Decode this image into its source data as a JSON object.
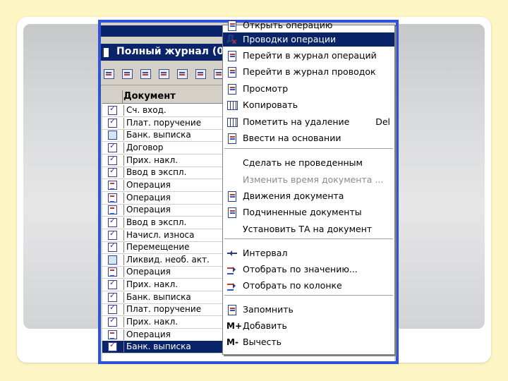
{
  "window": {
    "title": "Полный журнал (01"
  },
  "grid": {
    "column_header": "Документ",
    "rows": [
      {
        "name": "Сч. вход.",
        "mark": "check"
      },
      {
        "name": "Плат. поручение",
        "mark": "check"
      },
      {
        "name": "Банк. выписка",
        "mark": "plain"
      },
      {
        "name": "Договор",
        "mark": "check"
      },
      {
        "name": "Прих. накл.",
        "mark": "check"
      },
      {
        "name": "Ввод в экспл.",
        "mark": "check"
      },
      {
        "name": "Операция",
        "mark": "op"
      },
      {
        "name": "Операция",
        "mark": "op"
      },
      {
        "name": "Операция",
        "mark": "op"
      },
      {
        "name": "Ввод в экспл.",
        "mark": "check"
      },
      {
        "name": "Начисл. износа",
        "mark": "check"
      },
      {
        "name": "Перемещение",
        "mark": "check"
      },
      {
        "name": "Ликвид. необ. акт.",
        "mark": "plain"
      },
      {
        "name": "Операция",
        "mark": "op"
      },
      {
        "name": "Прих. накл.",
        "mark": "check"
      },
      {
        "name": "Банк. выписка",
        "mark": "check"
      },
      {
        "name": "Плат. поручение",
        "mark": "check"
      },
      {
        "name": "Прих. накл.",
        "mark": "check"
      },
      {
        "name": "Операция",
        "mark": "op"
      },
      {
        "name": "Банк. выписка",
        "mark": "check"
      }
    ]
  },
  "context_menu": {
    "items": [
      {
        "label": "Открыть операцию",
        "icon": "document-icon"
      },
      {
        "label": "Проводки операции",
        "icon": "ddt-icon"
      },
      {
        "label": "Перейти в журнал операций",
        "icon": "journal-icon"
      },
      {
        "label": "Перейти в журнал проводок",
        "icon": "journal-icon"
      },
      {
        "label": "Просмотр",
        "icon": "view-icon"
      },
      {
        "label": "Копировать",
        "icon": "copy-icon"
      },
      {
        "label": "Пометить на удаление",
        "icon": "delete-mark-icon",
        "shortcut": "Del"
      },
      {
        "label": "Ввести на основании",
        "icon": "based-on-icon"
      },
      {
        "label": "Сделать не проведенным"
      },
      {
        "label": "Изменить время документа ..."
      },
      {
        "label": "Движения документа",
        "icon": "movements-icon"
      },
      {
        "label": "Подчиненные документы",
        "icon": "subordinate-icon"
      },
      {
        "label": "Установить ТА на документ"
      },
      {
        "label": "Интервал",
        "icon": "interval-icon"
      },
      {
        "label": "Отобрать по значению...",
        "icon": "filter-value-icon"
      },
      {
        "label": "Отобрать по колонке",
        "icon": "filter-column-icon"
      },
      {
        "label": "Запомнить",
        "icon": "remember-icon"
      },
      {
        "label": "Добавить",
        "icon_text": "M+"
      },
      {
        "label": "Вычесть",
        "icon_text": "M-"
      }
    ]
  },
  "colors": {
    "highlight": "#0a246a",
    "frame": "#2e52d8",
    "background": "#fdf5c3"
  }
}
